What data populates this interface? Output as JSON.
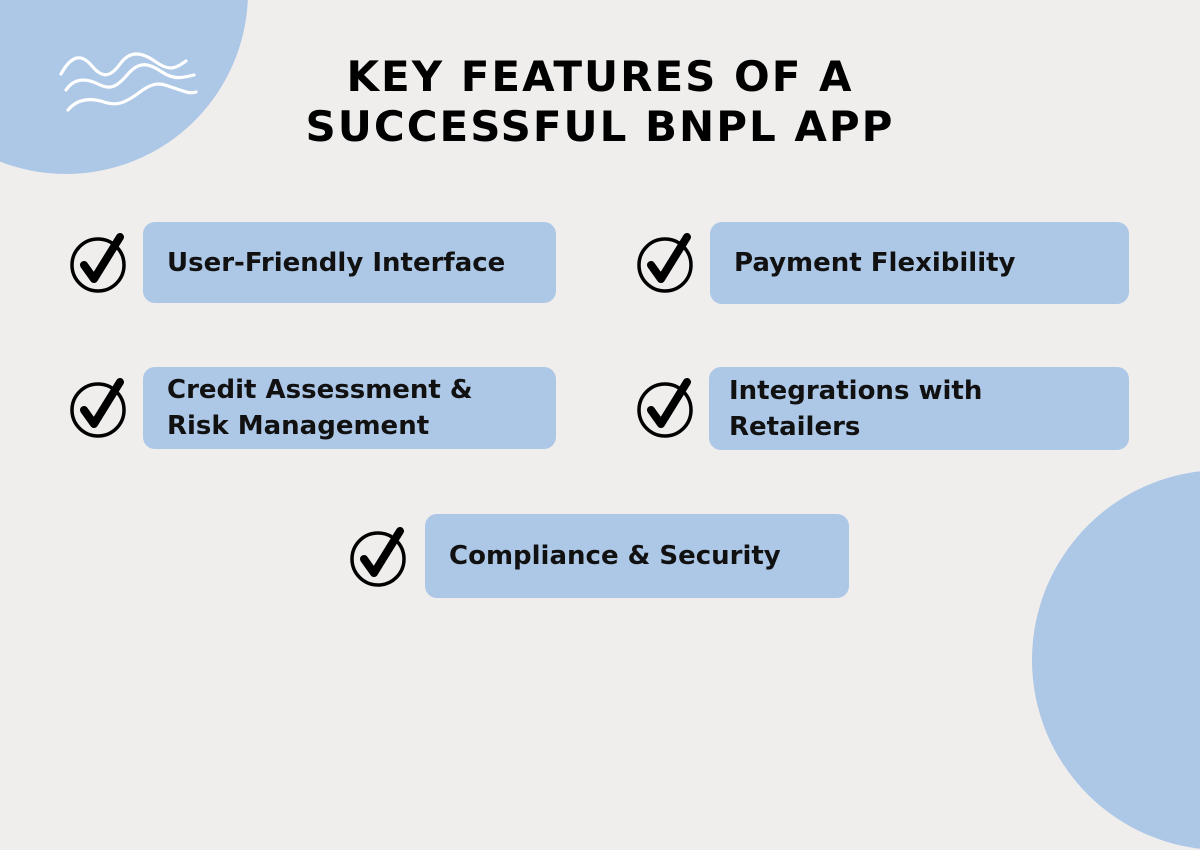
{
  "title": {
    "line1": "KEY FEATURES OF A",
    "line2": "SUCCESSFUL BNPL APP"
  },
  "colors": {
    "background": "#f0eeed",
    "accent_blue": "#adc7e6",
    "text": "#111111"
  },
  "decorations": {
    "top_left_icon": "waves-icon",
    "check_icon": "circled-check-icon"
  },
  "features": [
    {
      "label": "User-Friendly Interface"
    },
    {
      "label": "Payment Flexibility"
    },
    {
      "label": "Credit Assessment &\nRisk Management"
    },
    {
      "label": "Integrations with\nRetailers"
    },
    {
      "label": "Compliance & Security"
    }
  ]
}
